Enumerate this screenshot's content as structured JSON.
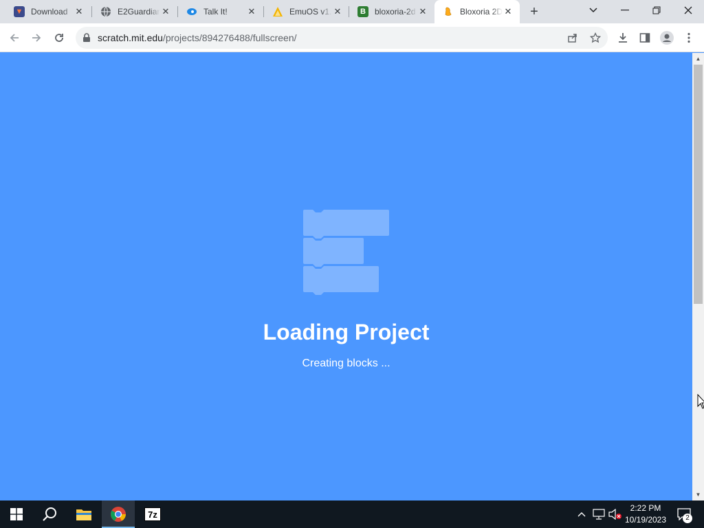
{
  "tabs": [
    {
      "label": "Download",
      "icon": "fox-shield-icon",
      "active": false
    },
    {
      "label": "E2Guardian",
      "icon": "globe-icon",
      "active": false
    },
    {
      "label": "Talk It!",
      "icon": "talkit-icon",
      "active": false
    },
    {
      "label": "EmuOS v1.",
      "icon": "emuos-icon",
      "active": false
    },
    {
      "label": "bloxoria-2d",
      "icon": "b-letter-icon",
      "active": false
    },
    {
      "label": "Bloxoria 2D",
      "icon": "scratch-cat-icon",
      "active": true
    }
  ],
  "new_tab_label": "+",
  "address_bar": {
    "host": "scratch.mit.edu",
    "path": "/projects/894276488/fullscreen/"
  },
  "loading": {
    "title": "Loading Project",
    "subtitle": "Creating blocks ..."
  },
  "taskbar": {
    "time": "2:22 PM",
    "date": "10/19/2023",
    "notification_count": "2",
    "sevenzip_label": "7z"
  },
  "colors": {
    "stage_bg": "#4c97ff",
    "block_fill": "#7fb4ff",
    "taskbar_bg": "#101820"
  }
}
